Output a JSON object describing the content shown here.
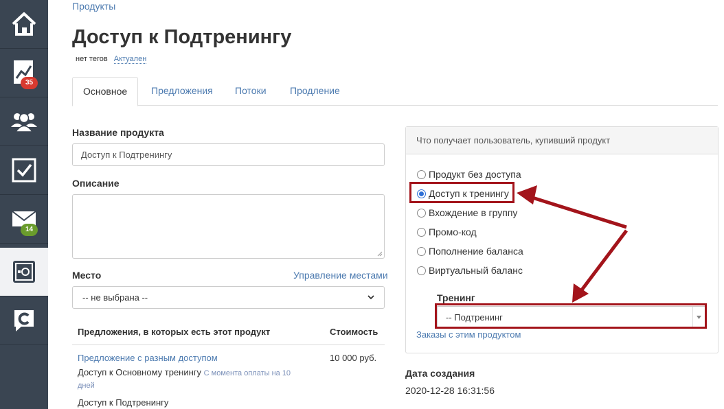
{
  "sidebar": {
    "items": [
      {
        "icon": "home-icon"
      },
      {
        "icon": "chart-icon",
        "badge": "35"
      },
      {
        "icon": "users-icon"
      },
      {
        "icon": "checkbox-icon"
      },
      {
        "icon": "mail-icon",
        "badge": "14"
      },
      {
        "icon": "safe-icon",
        "active": true
      },
      {
        "icon": "logo-icon"
      }
    ]
  },
  "header": {
    "breadcrumb": "Продукты",
    "title": "Доступ к Подтренингу",
    "tags_text": "нет тегов",
    "status_link": "Актуален"
  },
  "tabs": [
    "Основное",
    "Предложения",
    "Потоки",
    "Продление"
  ],
  "form": {
    "name_label": "Название продукта",
    "name_value": "Доступ к Подтренингу",
    "description_label": "Описание",
    "place_label": "Место",
    "manage_places_link": "Управление местами",
    "place_value": "-- не выбрана --"
  },
  "offers_table": {
    "headers": [
      "Предложения, в которых есть этот продукт",
      "Стоимость"
    ],
    "rows": [
      {
        "offer_link": "Предложение с разным доступом",
        "price": "10 000 руб.",
        "item1": "Доступ к Основному тренингу",
        "item1_note_a": "С момента оплаты на 10",
        "item1_note_b": "дней",
        "item2": "Доступ к Подтренингу"
      }
    ]
  },
  "panel": {
    "title": "Что получает пользователь, купивший продукт",
    "options": [
      "Продукт без доступа",
      "Доступ к тренингу",
      "Вхождение в группу",
      "Промо-код",
      "Пополнение баланса",
      "Виртуальный баланс"
    ],
    "selected_index": 1,
    "training_label": "Тренинг",
    "training_value": "-- Подтренинг",
    "orders_link": "Заказы с этим продуктом"
  },
  "created": {
    "label": "Дата создания",
    "value": "2020-12-28 16:31:56"
  },
  "colors": {
    "sidebar": "#3a4552",
    "link": "#4d7bb0",
    "highlight": "#a3141b",
    "badge_red": "#d73a30",
    "badge_green": "#6a9c2c"
  }
}
